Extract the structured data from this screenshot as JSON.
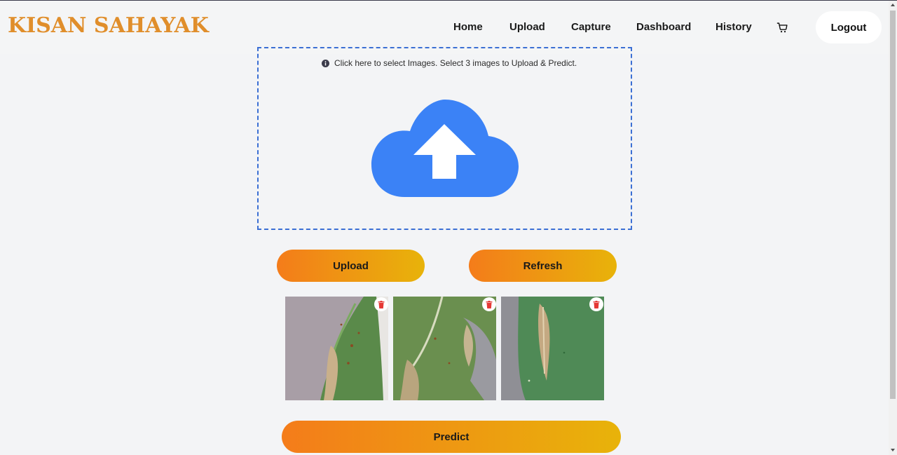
{
  "brand": "KISAN SAHAYAK",
  "nav": {
    "home": "Home",
    "upload": "Upload",
    "capture": "Capture",
    "dashboard": "Dashboard",
    "history": "History",
    "cart_icon": "cart-icon",
    "logout": "Logout"
  },
  "dropzone": {
    "hint": "Click here to select Images. Select 3 images to Upload & Predict.",
    "icon": "cloud-upload-icon"
  },
  "buttons": {
    "upload": "Upload",
    "refresh": "Refresh",
    "predict": "Predict"
  },
  "images": [
    {
      "name": "leaf-image-1",
      "delete_icon": "trash-icon"
    },
    {
      "name": "leaf-image-2",
      "delete_icon": "trash-icon"
    },
    {
      "name": "leaf-image-3",
      "delete_icon": "trash-icon"
    }
  ],
  "colors": {
    "brand": "#e08e2b",
    "accent_start": "#f47c1a",
    "accent_end": "#e8b30a",
    "upload_icon": "#3b82f6",
    "dropzone_border": "#3b6fd4",
    "delete": "#e53935"
  }
}
